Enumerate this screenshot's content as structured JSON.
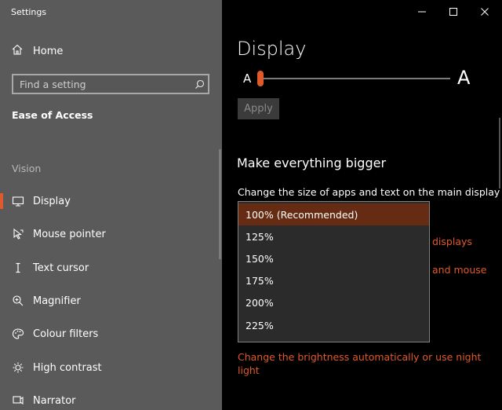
{
  "window": {
    "title": "Settings"
  },
  "sidebar": {
    "home_label": "Home",
    "search_placeholder": "Find a setting",
    "section_title": "Ease of Access",
    "group_label": "Vision",
    "items": [
      {
        "label": "Display",
        "icon": "monitor-icon",
        "selected": true
      },
      {
        "label": "Mouse pointer",
        "icon": "mouse-pointer-icon"
      },
      {
        "label": "Text cursor",
        "icon": "text-cursor-icon"
      },
      {
        "label": "Magnifier",
        "icon": "magnifier-icon"
      },
      {
        "label": "Colour filters",
        "icon": "palette-icon"
      },
      {
        "label": "High contrast",
        "icon": "sun-icon"
      },
      {
        "label": "Narrator",
        "icon": "narrator-icon"
      }
    ]
  },
  "main": {
    "title": "Display",
    "slider": {
      "small_label": "A",
      "large_label": "A",
      "value": 0
    },
    "apply_label": "Apply",
    "heading": "Make everything bigger",
    "description": "Change the size of apps and text on the main display",
    "dropdown": {
      "options": [
        "100% (Recommended)",
        "125%",
        "150%",
        "175%",
        "200%",
        "225%"
      ],
      "selected_index": 0
    },
    "link1_tail": "displays",
    "link2_tail": "and mouse",
    "brightness_link_line1": "Change the brightness automatically or use night",
    "brightness_link_line2": "light"
  },
  "colors": {
    "accent": "#e0592a",
    "sidebar_bg": "#5a5a5a",
    "main_bg": "#000000",
    "dropdown_selected": "#652b13"
  }
}
